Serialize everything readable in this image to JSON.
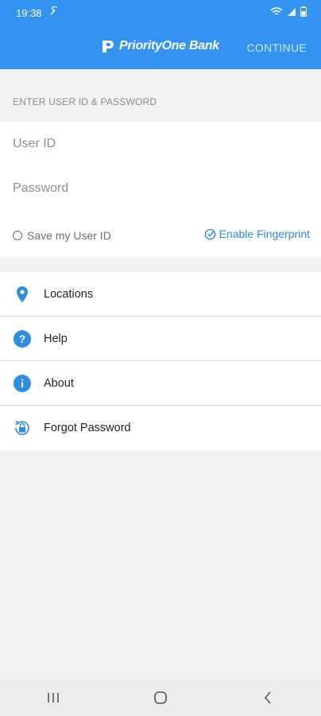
{
  "status_bar": {
    "time": "19:38"
  },
  "app_bar": {
    "brand": "PriorityOne Bank",
    "continue_label": "CONTINUE"
  },
  "login": {
    "section_label": "ENTER USER ID & PASSWORD",
    "user_id_placeholder": "User ID",
    "password_placeholder": "Password",
    "save_user_id_label": "Save my User ID",
    "enable_fingerprint_label": "Enable Fingerprint"
  },
  "menu": {
    "items": [
      {
        "label": "Locations",
        "icon": "location-pin-icon"
      },
      {
        "label": "Help",
        "icon": "help-icon"
      },
      {
        "label": "About",
        "icon": "info-icon"
      },
      {
        "label": "Forgot Password",
        "icon": "lock-reset-icon"
      }
    ]
  },
  "colors": {
    "primary": "#3393f0",
    "accent": "#2e8be6"
  }
}
